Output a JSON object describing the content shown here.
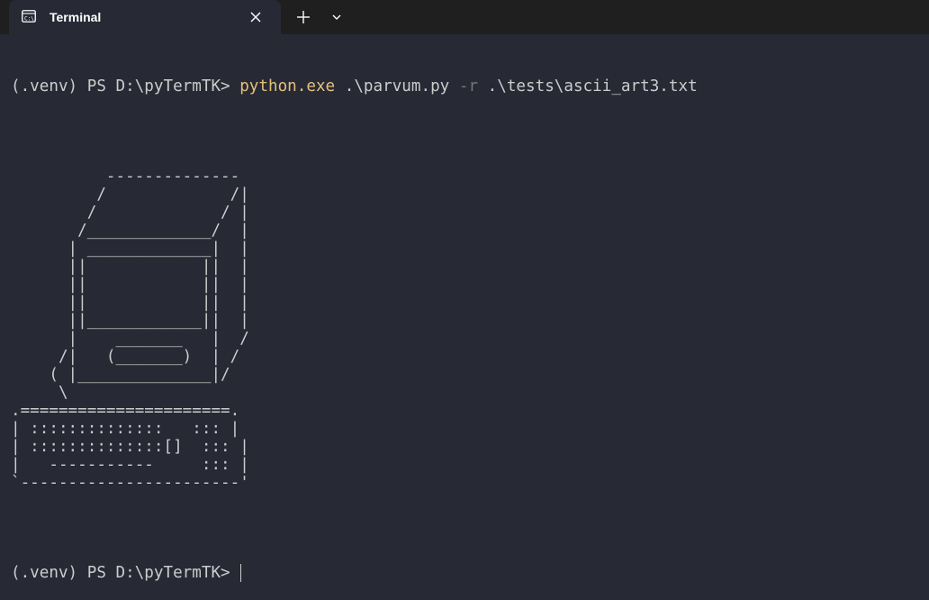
{
  "tab": {
    "title": "Terminal",
    "icon": "terminal-icon",
    "close_icon": "close-icon",
    "new_tab_icon": "plus-icon",
    "dropdown_icon": "chevron-down-icon"
  },
  "command_line": {
    "prompt": "(.venv) PS D:\\pyTermTK> ",
    "command": "python.exe",
    "arg1": " .\\parvum.py ",
    "flag": "-r",
    "arg2": " .\\tests\\ascii_art3.txt"
  },
  "ascii_art": [
    "",
    "",
    "          --------------",
    "         /             /|",
    "        /             / |",
    "       /_____________/  |",
    "      | _____________|  |",
    "      ||            ||  |",
    "      ||            ||  |",
    "      ||            ||  |",
    "      ||____________||  |",
    "      |    _______   |  /",
    "     /|   (_______)  | /",
    "    ( |______________|/",
    "     \\",
    ".======================.",
    "| ::::::::::::::   ::: |",
    "| ::::::::::::::[]  ::: |",
    "|   -----------     ::: |",
    "`-----------------------'",
    "",
    ""
  ],
  "final_prompt": "(.venv) PS D:\\pyTermTK> ",
  "colors": {
    "background": "#272a35",
    "titlebar": "#1f1f1f",
    "text": "#cccccc",
    "command": "#e5c07b",
    "flag": "#767676"
  }
}
